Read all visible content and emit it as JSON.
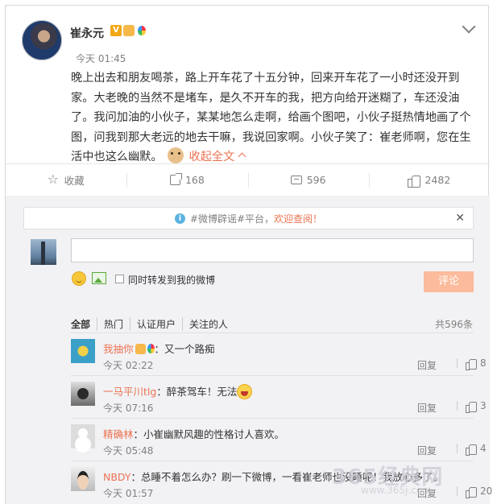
{
  "post": {
    "author": "崔永元",
    "time": "今天 01:45",
    "text": "晚上出去和朋友喝茶，路上开车花了十五分钟，回来开车花了一小时还没开到家。大老晚的当然不是堵车，是久不开车的我，把方向给开迷糊了，车还没油了。我问加油的小伙子，某某地怎么走啊，给画个图吧，小伙子挺热情地画了个图，问我到那大老远的地去干嘛，我说回家啊。小伙子笑了：崔老师啊，您在生活中也这么幽默。",
    "collapse_label": "收起全文"
  },
  "actions": {
    "favorite": "收藏",
    "share_count": "168",
    "comment_count": "596",
    "like_count": "2482"
  },
  "notice": {
    "tag": "#微博辟谣#平台，",
    "link": "欢迎查阅！"
  },
  "composer": {
    "forward_label": "同时转发到我的微博",
    "submit_label": "评论"
  },
  "filters": [
    "全部",
    "热门",
    "认证用户",
    "关注的人"
  ],
  "total": "共596条",
  "comments": [
    {
      "name": "我抽你",
      "text": "：又一个路痴",
      "time": "今天 02:22",
      "reply": "回复",
      "likes": "8"
    },
    {
      "name": "一马平川tlg",
      "text": "：醉茶驾车！无法",
      "time": "今天 07:16",
      "reply": "回复",
      "likes": "3"
    },
    {
      "name": "精确林",
      "text": "：小崔幽默风趣的性格讨人喜欢。",
      "time": "今天 05:48",
      "reply": "回复",
      "likes": "4"
    },
    {
      "name": "NBDY",
      "text": "：总睡不着怎么办？刷一下微博，一看崔老师也没睡呢！我放心多了。",
      "time": "今天 01:57",
      "reply": "回复",
      "likes": "20"
    }
  ],
  "watermark": {
    "main": "365经典网",
    "sub": "www.365j.com"
  }
}
